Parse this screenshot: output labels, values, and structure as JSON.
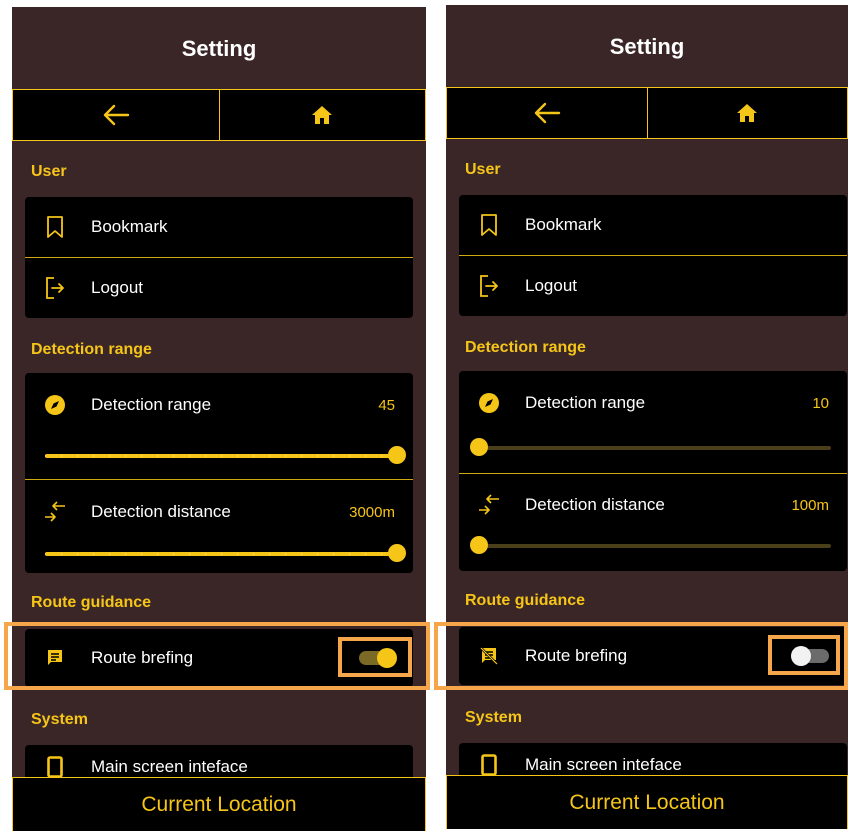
{
  "colors": {
    "accent": "#f5c518",
    "background": "#3a2626",
    "card": "#000000",
    "highlight": "#f5a54a"
  },
  "panels": [
    {
      "title": "Setting",
      "nav": {
        "back_icon": "arrow-left-icon",
        "home_icon": "home-icon"
      },
      "sections": {
        "user": "User",
        "detection": "Detection range",
        "route": "Route guidance",
        "system": "System"
      },
      "user": {
        "bookmark": "Bookmark",
        "logout": "Logout"
      },
      "detection": {
        "range_label": "Detection range",
        "range_value": "45",
        "range_fraction": 1.0,
        "distance_label": "Detection distance",
        "distance_value": "3000m",
        "distance_fraction": 1.0
      },
      "route": {
        "briefing_label": "Route brefing",
        "briefing_on": true
      },
      "system": {
        "main_screen": "Main screen inteface"
      },
      "bottom": {
        "current_location": "Current Location"
      }
    },
    {
      "title": "Setting",
      "nav": {
        "back_icon": "arrow-left-icon",
        "home_icon": "home-icon"
      },
      "sections": {
        "user": "User",
        "detection": "Detection range",
        "route": "Route guidance",
        "system": "System"
      },
      "user": {
        "bookmark": "Bookmark",
        "logout": "Logout"
      },
      "detection": {
        "range_label": "Detection range",
        "range_value": "10",
        "range_fraction": 0.0,
        "distance_label": "Detection distance",
        "distance_value": "100m",
        "distance_fraction": 0.0
      },
      "route": {
        "briefing_label": "Route brefing",
        "briefing_on": false
      },
      "system": {
        "main_screen": "Main screen inteface"
      },
      "bottom": {
        "current_location": "Current Location"
      }
    }
  ]
}
